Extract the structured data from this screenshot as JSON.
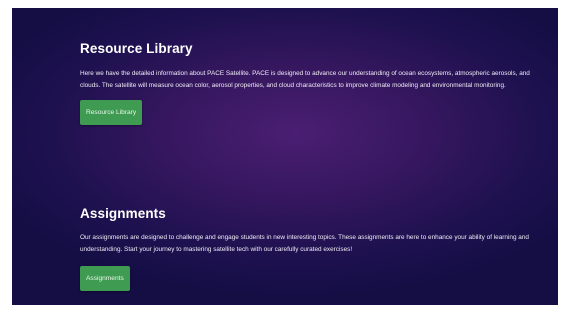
{
  "resource_library": {
    "title": "Resource Library",
    "description": "Here we have the detailed information about PACE Satellite. PACE is designed to advance our understanding of ocean ecosystems, atmospheric aerosols, and clouds. The satellite will measure ocean color, aerosol properties, and cloud characteristics to improve climate modeling and environmental monitoring.",
    "button_label": "Resource Library"
  },
  "assignments": {
    "title": "Assignments",
    "description": "Our assignments are designed to challenge and engage students in new interesting topics. These assignments are here to enhance your ability of learning and understanding. Start your journey to mastering satellite tech with our carefully curated exercises!",
    "button_label": "Assignments"
  },
  "colors": {
    "background_center": "#4a1f73",
    "background_edge": "#150e45",
    "button_green": "#3f9a52",
    "text": "#ffffff"
  }
}
